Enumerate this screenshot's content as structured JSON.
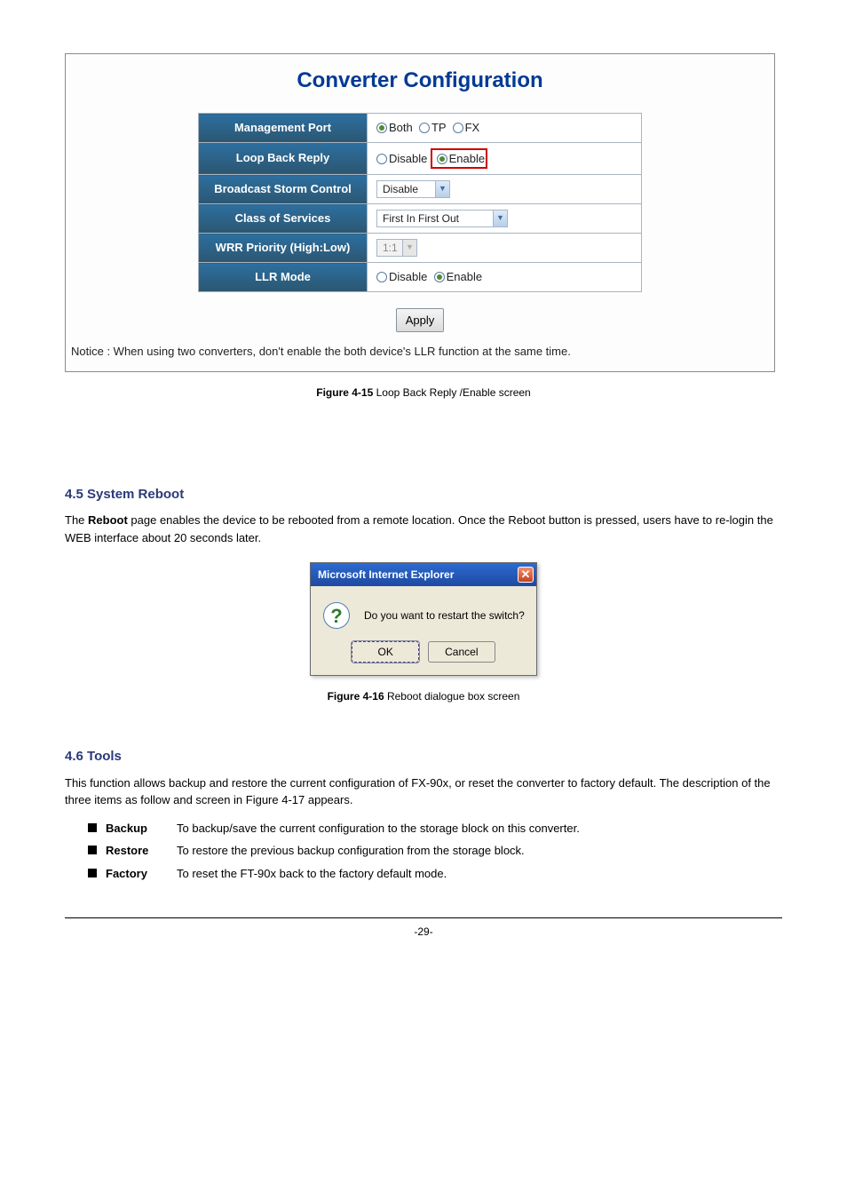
{
  "converter": {
    "title": "Converter Configuration",
    "rows": {
      "mgmt_label": "Management Port",
      "mgmt_options": {
        "both": "Both",
        "tp": "TP",
        "fx": "FX"
      },
      "lbr_label": "Loop Back Reply",
      "lbr_options": {
        "disable": "Disable",
        "enable": "Enable"
      },
      "bsc_label": "Broadcast Storm Control",
      "bsc_value": "Disable",
      "cos_label": "Class of Services",
      "cos_value": "First In First Out",
      "wrr_label": "WRR Priority (High:Low)",
      "wrr_value": "1:1",
      "llr_label": "LLR Mode",
      "llr_options": {
        "disable": "Disable",
        "enable": "Enable"
      }
    },
    "apply": "Apply",
    "notice": "Notice : When using two converters, don't enable the both device's LLR function at the same time."
  },
  "fig1": {
    "prefix": "Figure 4-15",
    "text": " Loop Back Reply /Enable screen"
  },
  "sec1": {
    "heading": "4.5 System Reboot",
    "para_a": "The ",
    "para_b": "Reboot",
    "para_c": " page enables the device to be rebooted from a remote location. Once the Reboot button is pressed, users have to re-login the WEB interface about 20 seconds later."
  },
  "dialog": {
    "title": "Microsoft Internet Explorer",
    "message": "Do you want to restart the switch?",
    "ok": "OK",
    "cancel": "Cancel"
  },
  "fig2": {
    "prefix": "Figure 4-16",
    "text": " Reboot dialogue box screen"
  },
  "sec2": {
    "heading": "4.6 Tools",
    "para": "This function allows backup and restore the current configuration of FX-90x, or reset the converter to factory default.  The description of the three items as follow and screen in Figure 4-17 appears.",
    "items": [
      {
        "label": "Backup",
        "text": "To backup/save the current configuration to the storage block on this converter."
      },
      {
        "label": "Restore",
        "text": " To restore the previous backup configuration from the storage block."
      },
      {
        "label": "Factory",
        "text": " To reset the FT-90x back to the factory default mode."
      }
    ]
  },
  "footer": {
    "page": "-29-"
  }
}
